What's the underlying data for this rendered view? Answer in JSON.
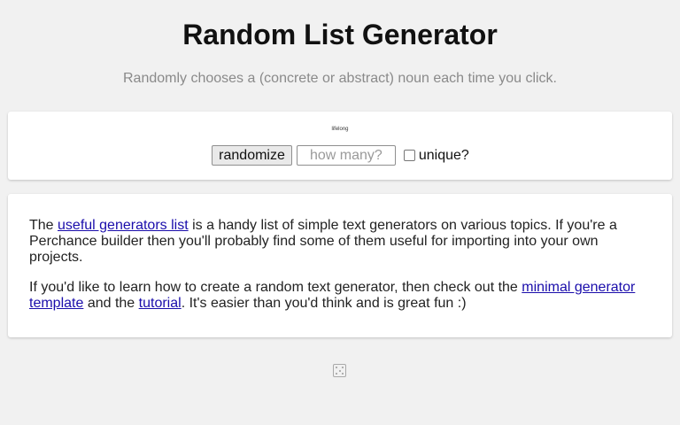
{
  "header": {
    "title": "Random List Generator",
    "subtitle": "Randomly chooses a (concrete or abstract) noun each time you click."
  },
  "generator": {
    "result": "lifelong",
    "randomize_label": "randomize",
    "count_placeholder": "how many?",
    "count_value": "",
    "unique_label": "unique?",
    "unique_checked": false
  },
  "info": {
    "p1_before": "The ",
    "p1_link": "useful generators list",
    "p1_after": " is a handy list of simple text generators on various topics. If you're a Perchance builder then you'll probably find some of them useful for importing into your own projects.",
    "p2_before": "If you'd like to learn how to create a random text generator, then check out the ",
    "p2_link1": "minimal generator template",
    "p2_middle": " and the ",
    "p2_link2": "tutorial",
    "p2_after": ". It's easier than you'd think and is great fun :)"
  },
  "footer": {
    "icon": "dice-icon"
  },
  "colors": {
    "background": "#f1f1f1",
    "card": "#ffffff",
    "link": "#1a0dab",
    "subtitle": "#8a8a8a"
  }
}
